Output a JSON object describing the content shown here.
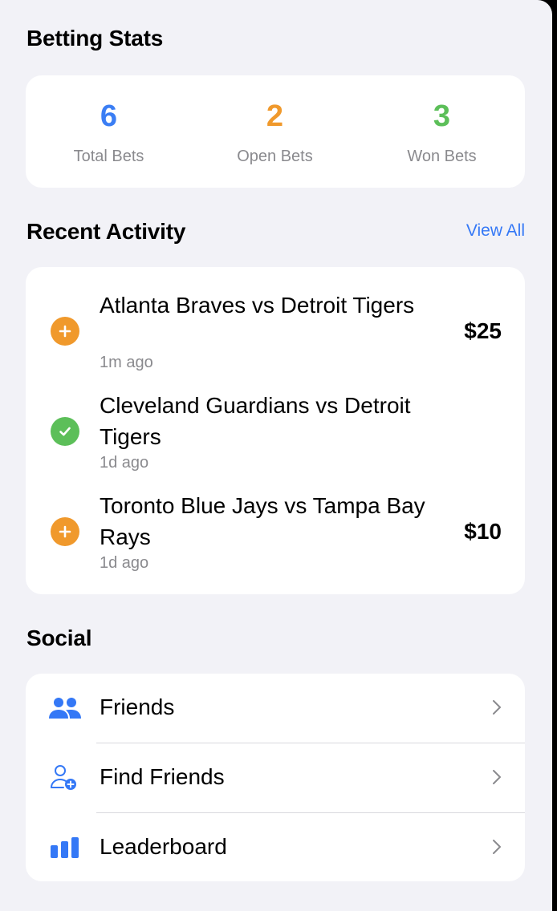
{
  "stats": {
    "title": "Betting Stats",
    "items": [
      {
        "value": "6",
        "label": "Total Bets",
        "color": "#3b7ef4"
      },
      {
        "value": "2",
        "label": "Open Bets",
        "color": "#f0992c"
      },
      {
        "value": "3",
        "label": "Won Bets",
        "color": "#5cbf59"
      }
    ]
  },
  "activity": {
    "title": "Recent Activity",
    "view_all": "View All",
    "items": [
      {
        "title": "Atlanta Braves vs Detroit Tigers",
        "time": "1m ago",
        "amount": "$25",
        "status": "open",
        "icon": "plus-circle-icon"
      },
      {
        "title": "Cleveland Guardians vs Detroit Tigers",
        "time": "1d ago",
        "amount": "",
        "status": "won",
        "icon": "checkmark-circle-icon"
      },
      {
        "title": "Toronto Blue Jays vs Tampa Bay Rays",
        "time": "1d ago",
        "amount": "$10",
        "status": "open",
        "icon": "plus-circle-icon"
      }
    ],
    "colors": {
      "open": "#f0992c",
      "won": "#5cbf59"
    }
  },
  "social": {
    "title": "Social",
    "items": [
      {
        "label": "Friends",
        "icon": "people-icon"
      },
      {
        "label": "Find Friends",
        "icon": "add-person-icon"
      },
      {
        "label": "Leaderboard",
        "icon": "bar-chart-icon"
      }
    ],
    "accent": "#3478f6"
  }
}
